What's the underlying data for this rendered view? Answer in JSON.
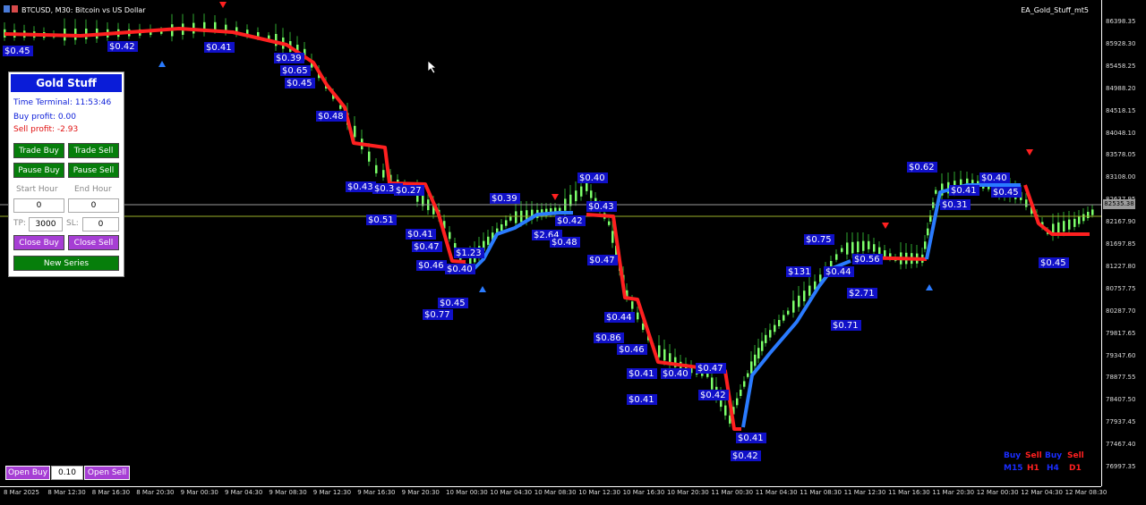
{
  "window": {
    "title": "BTCUSD, M30:  Bitcoin vs US Dollar",
    "ea_name": "EA_Gold_Stuff_mt5"
  },
  "y_axis": {
    "ticks": [
      "86398.35",
      "85928.30",
      "85458.25",
      "84988.20",
      "84518.15",
      "84048.10",
      "83578.05",
      "83108.00",
      "82637.95",
      "82167.90",
      "81697.85",
      "81227.80",
      "80757.75",
      "80287.70",
      "79817.65",
      "79347.60",
      "78877.55",
      "78407.50",
      "77937.45",
      "77467.40",
      "76997.35"
    ],
    "current_price_tag": "82535.38"
  },
  "x_axis": {
    "ticks": [
      "8 Mar 2025",
      "8 Mar 12:30",
      "8 Mar 16:30",
      "8 Mar 20:30",
      "9 Mar 00:30",
      "9 Mar 04:30",
      "9 Mar 08:30",
      "9 Mar 12:30",
      "9 Mar 16:30",
      "9 Mar 20:30",
      "10 Mar 00:30",
      "10 Mar 04:30",
      "10 Mar 08:30",
      "10 Mar 12:30",
      "10 Mar 16:30",
      "10 Mar 20:30",
      "11 Mar 00:30",
      "11 Mar 04:30",
      "11 Mar 08:30",
      "11 Mar 12:30",
      "11 Mar 16:30",
      "11 Mar 20:30",
      "12 Mar 00:30",
      "12 Mar 04:30",
      "12 Mar 08:30"
    ]
  },
  "panel": {
    "title": "Gold Stuff",
    "time_label": "Time Terminal: 11:53:46",
    "buy_profit": "Buy profit: 0.00",
    "sell_profit": "Sell profit: -2.93",
    "trade_buy": "Trade Buy",
    "trade_sell": "Trade Sell",
    "pause_buy": "Pause Buy",
    "pause_sell": "Pause Sell",
    "start_hour_label": "Start Hour",
    "end_hour_label": "End Hour",
    "start_hour": "0",
    "end_hour": "0",
    "tp_label": "TP:",
    "tp_value": "3000",
    "sl_label": "SL:",
    "sl_value": "0",
    "close_buy": "Close Buy",
    "close_sell": "Close Sell",
    "new_series": "New Series"
  },
  "bottom": {
    "open_buy": "Open Buy",
    "lot": "0.10",
    "open_sell": "Open Sell"
  },
  "tf_grid": {
    "row1": [
      "Buy",
      "Sell",
      "Buy",
      "Sell"
    ],
    "row2": [
      "M15",
      "H1",
      "H4",
      "D1"
    ]
  },
  "profit_labels": [
    "$0.45",
    "$0.42",
    "$0.41",
    "$0.39",
    "$0.65",
    "$0.45",
    "$0.48",
    "$0.43",
    "$0.39",
    "$0.27",
    "$0.51",
    "$0.41",
    "$0.47",
    "$0.46",
    "$0.40",
    "$0.45",
    "$0.77",
    "$1.23",
    "$0.39",
    "$0.42",
    "$0.40",
    "$0.43",
    "$2.64",
    "$0.48",
    "$0.47",
    "$0.44",
    "$0.86",
    "$0.46",
    "$0.41",
    "$0.40",
    "$0.47",
    "$0.42",
    "$0.41",
    "$0.42",
    "$0.41",
    "$0.75",
    "$131",
    "$0.44",
    "$2.71",
    "$0.71",
    "$0.56",
    "$0.62",
    "$0.41",
    "$0.45",
    "$0.40",
    "$0.31",
    "$0.45"
  ],
  "colors": {
    "sell_line": "#ff2020",
    "buy_line": "#2a7bff",
    "label_bg": "#1010c8",
    "candle_up": "#7cff6a"
  }
}
